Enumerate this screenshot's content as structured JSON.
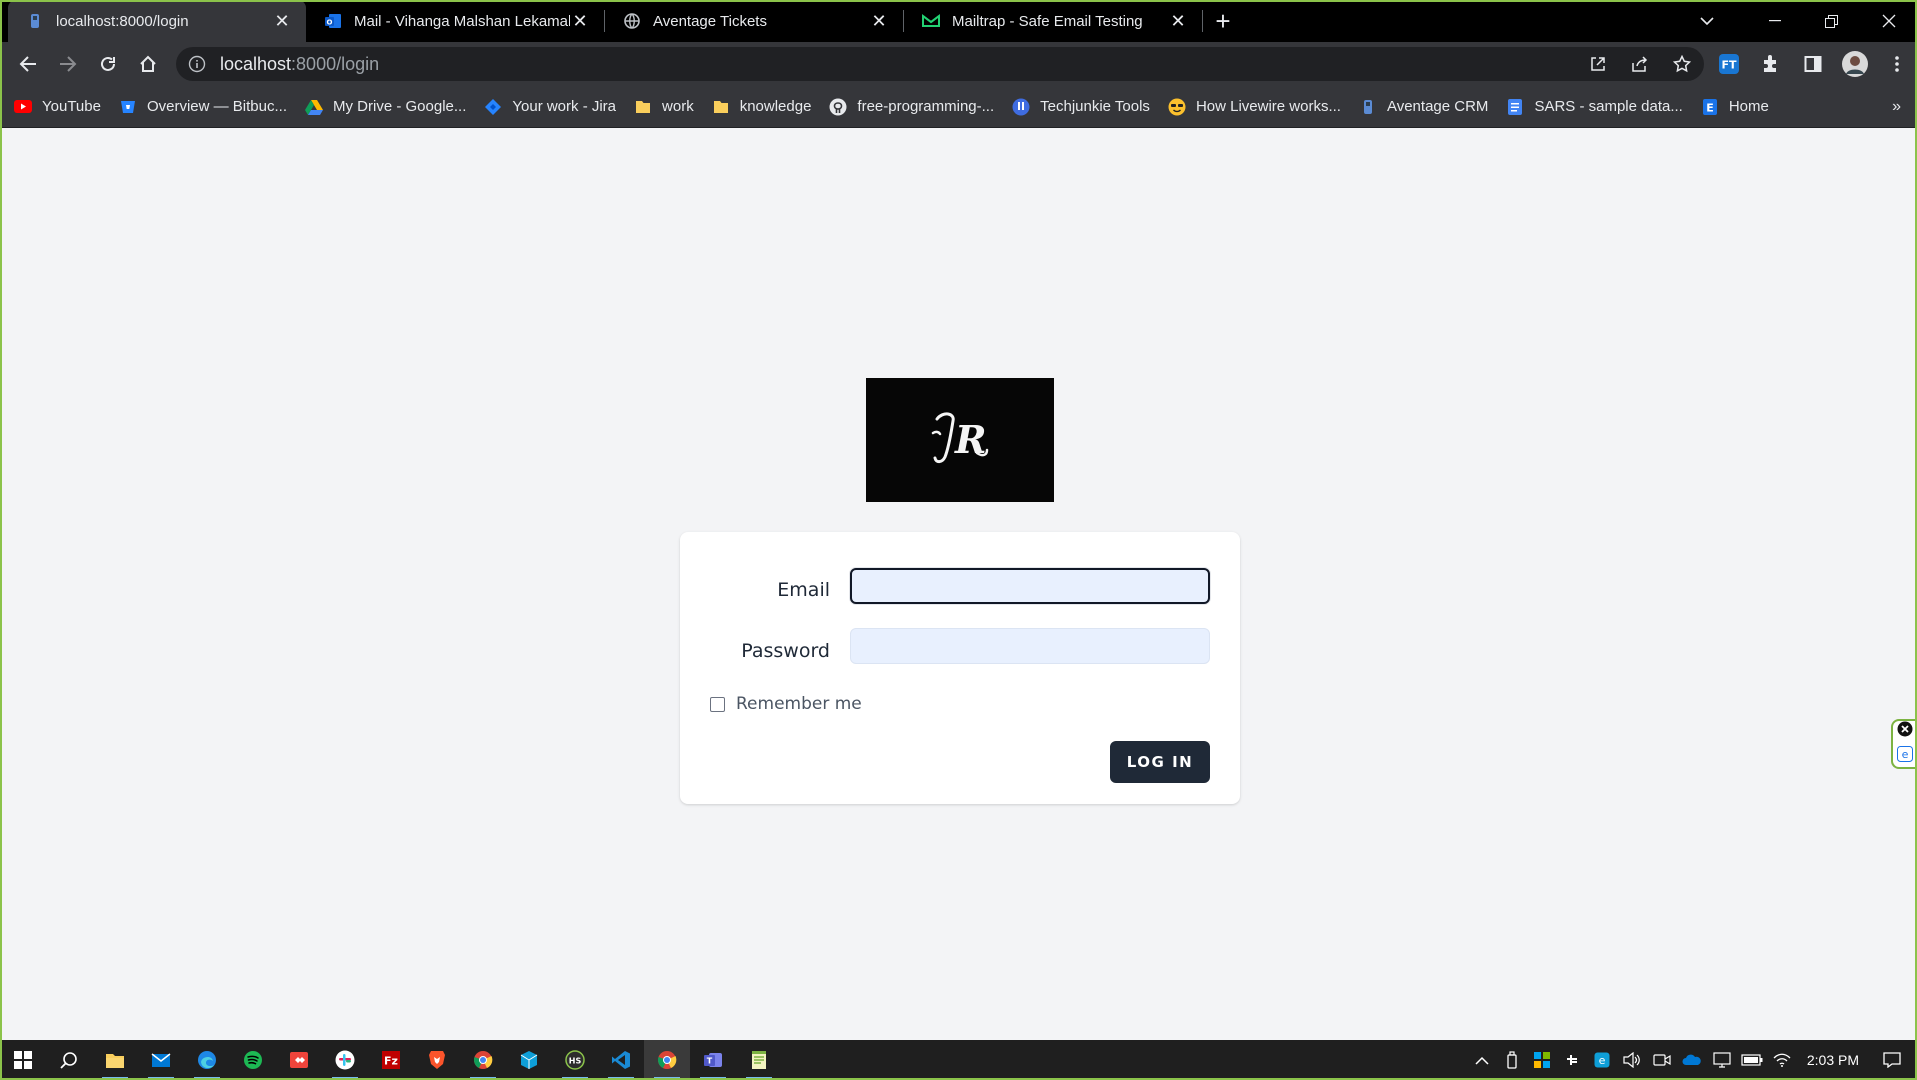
{
  "browser": {
    "tabs": [
      {
        "title": "localhost:8000/login",
        "active": true
      },
      {
        "title": "Mail - Vihanga Malshan Lekamal",
        "active": false
      },
      {
        "title": "Aventage Tickets",
        "active": false
      },
      {
        "title": "Mailtrap - Safe Email Testing",
        "active": false
      }
    ],
    "address": {
      "host": "localhost",
      "path": ":8000/login"
    },
    "bookmarks": [
      {
        "label": "YouTube",
        "icon": "youtube-icon"
      },
      {
        "label": "Overview — Bitbuc...",
        "icon": "bitbucket-icon"
      },
      {
        "label": "My Drive - Google...",
        "icon": "google-drive-icon"
      },
      {
        "label": "Your work - Jira",
        "icon": "jira-icon"
      },
      {
        "label": "work",
        "icon": "folder-icon"
      },
      {
        "label": "knowledge",
        "icon": "folder-icon"
      },
      {
        "label": "free-programming-...",
        "icon": "github-icon"
      },
      {
        "label": "Techjunkie Tools",
        "icon": "techjunkie-icon"
      },
      {
        "label": "How Livewire works...",
        "icon": "emoji-icon"
      },
      {
        "label": "Aventage CRM",
        "icon": "crm-icon"
      },
      {
        "label": "SARS - sample data...",
        "icon": "docs-icon"
      },
      {
        "label": "Home",
        "icon": "home-e-icon"
      }
    ]
  },
  "login": {
    "logo_text": "JR",
    "email_label": "Email",
    "email_value": "",
    "password_label": "Password",
    "password_value": "",
    "remember_label": "Remember me",
    "submit_label": "LOG IN"
  },
  "taskbar": {
    "time": "2:03 PM"
  },
  "colors": {
    "page_bg": "#f3f4f6",
    "button_bg": "#1f2937",
    "input_bg": "#e8f0fe",
    "logo_bg": "#060606"
  }
}
